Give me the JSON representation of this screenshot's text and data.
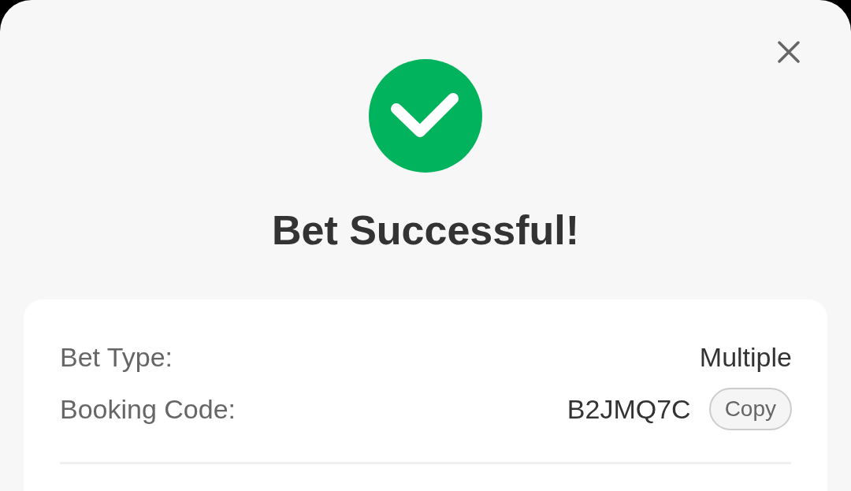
{
  "title": "Bet Successful!",
  "details": [
    {
      "label": "Bet Type:",
      "value": "Multiple"
    },
    {
      "label": "Booking Code:",
      "value": "B2JMQ7C",
      "action": "Copy"
    }
  ]
}
